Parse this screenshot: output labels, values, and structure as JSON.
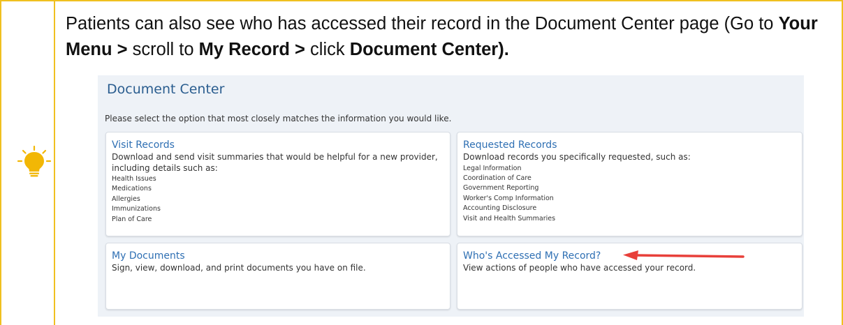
{
  "intro": {
    "part1": "Patients can also see who has accessed their record in the Document Center page (Go to ",
    "bold1": "Your Menu >",
    "part2": " scroll to ",
    "bold2": "My Record >",
    "part3": " click ",
    "bold3": "Document Center)."
  },
  "document_center": {
    "title": "Document Center",
    "subtitle": "Please select the option that most closely matches the information you would like.",
    "cards": [
      {
        "title": "Visit Records",
        "description": "Download and send visit summaries that would be helpful for a new provider, including details such as:",
        "items": [
          "Health Issues",
          "Medications",
          "Allergies",
          "Immunizations",
          "Plan of Care"
        ]
      },
      {
        "title": "Requested Records",
        "description": "Download records you specifically requested, such as:",
        "items": [
          "Legal Information",
          "Coordination of Care",
          "Government Reporting",
          "Worker's Comp Information",
          "Accounting Disclosure",
          "Visit and Health Summaries"
        ]
      },
      {
        "title": "My Documents",
        "description": "Sign, view, download, and print documents you have on file.",
        "items": []
      },
      {
        "title": "Who's Accessed My Record?",
        "description": "View actions of people who have accessed your record.",
        "items": []
      }
    ]
  },
  "icons": {
    "tip": "lightbulb-icon",
    "pointer": "red-arrow-icon"
  },
  "colors": {
    "border": "#f0c020",
    "bulb": "#f2b705",
    "link": "#2e6fb3",
    "arrow": "#e8403a",
    "panel": "#eef2f7"
  }
}
